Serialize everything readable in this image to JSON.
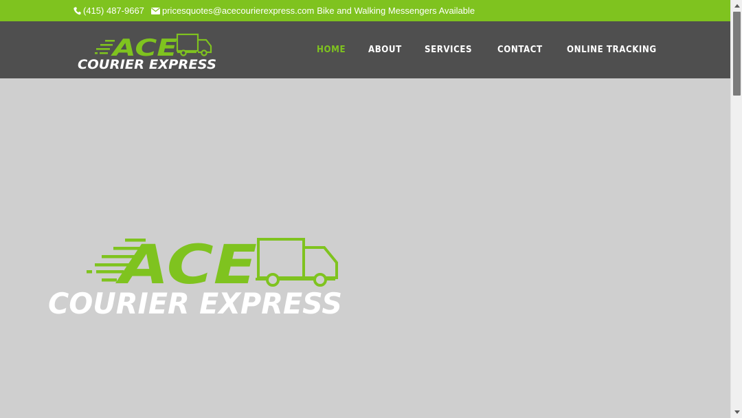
{
  "topbar": {
    "phone": "(415) 487-9667",
    "email": "pricesquotes@acecourierexpress.com",
    "tagline": "Bike and Walking Messengers Available",
    "phone_icon": "phone-icon",
    "email_icon": "envelope-icon"
  },
  "logo": {
    "top_text": "ACE",
    "bottom_text": "COURIER EXPRESS"
  },
  "nav": {
    "items": [
      {
        "label": "HOME",
        "active": true
      },
      {
        "label": "ABOUT",
        "active": false
      },
      {
        "label": "SERVICES",
        "active": false
      },
      {
        "label": "CONTACT",
        "active": false
      },
      {
        "label": "ONLINE TRACKING",
        "active": false
      }
    ]
  },
  "hero": {
    "logo_top_text": "ACE",
    "logo_bottom_text": "COURIER EXPRESS"
  },
  "colors": {
    "accent_green": "#7fc31f",
    "header_bg": "#4f4f4f",
    "hero_bg": "#cfcfcf",
    "white": "#ffffff"
  }
}
